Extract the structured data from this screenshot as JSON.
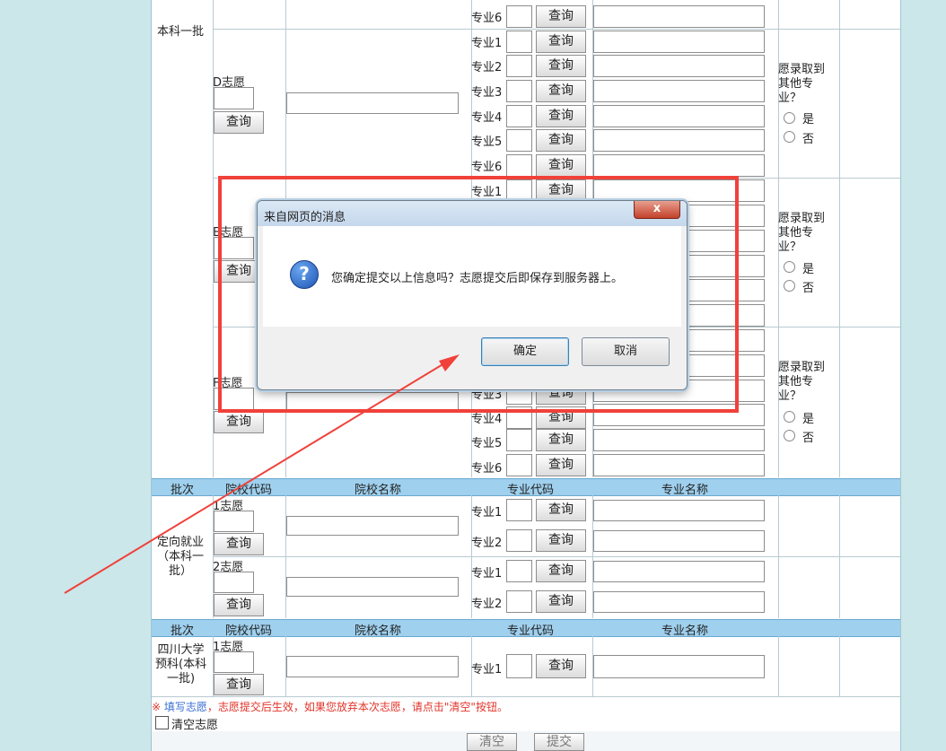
{
  "batch1": {
    "label": "本科一批"
  },
  "major_prefix": [
    "专业1",
    "专业2",
    "专业3",
    "专业4",
    "专业5",
    "专业6"
  ],
  "query_label": "查询",
  "choice_d": {
    "label": "D志愿"
  },
  "choice_e": {
    "label": "E志愿"
  },
  "choice_f": {
    "label": "F志愿"
  },
  "adjust": {
    "line1": "愿录取到",
    "line2": "其他专",
    "line3": "业？",
    "yes": "是",
    "no": "否"
  },
  "table_header": {
    "batch": "批次",
    "school_code": "院校代码",
    "school_name": "院校名称",
    "major_code": "专业代码",
    "major_name": "专业名称"
  },
  "directed": {
    "line1": "定向就业",
    "line2": "（本科一",
    "line3": "批）",
    "choice1": "1志愿",
    "choice2": "2志愿"
  },
  "sichuan": {
    "line1": "四川大学",
    "line2": "预科(本科",
    "line3": "一批)",
    "choice1": "1志愿"
  },
  "notice": {
    "mark": "※",
    "prefix": "填写志愿",
    "text": "，志愿提交后生效，如果您放弃本次志愿，请点击\"清空\"按钮。"
  },
  "clear_checkbox_label": "清空志愿",
  "bottom_buttons": {
    "clear": "清空",
    "submit": "提交"
  },
  "dialog": {
    "title": "来自网页的消息",
    "message": "您确定提交以上信息吗？志愿提交后即保存到服务器上。",
    "ok": "确定",
    "cancel": "取消",
    "close": "x"
  },
  "colors": {
    "highlight": "#f0413a",
    "header": "#9fd0ee",
    "notice": "#e2342a",
    "notice_link": "#3a6fd4"
  }
}
